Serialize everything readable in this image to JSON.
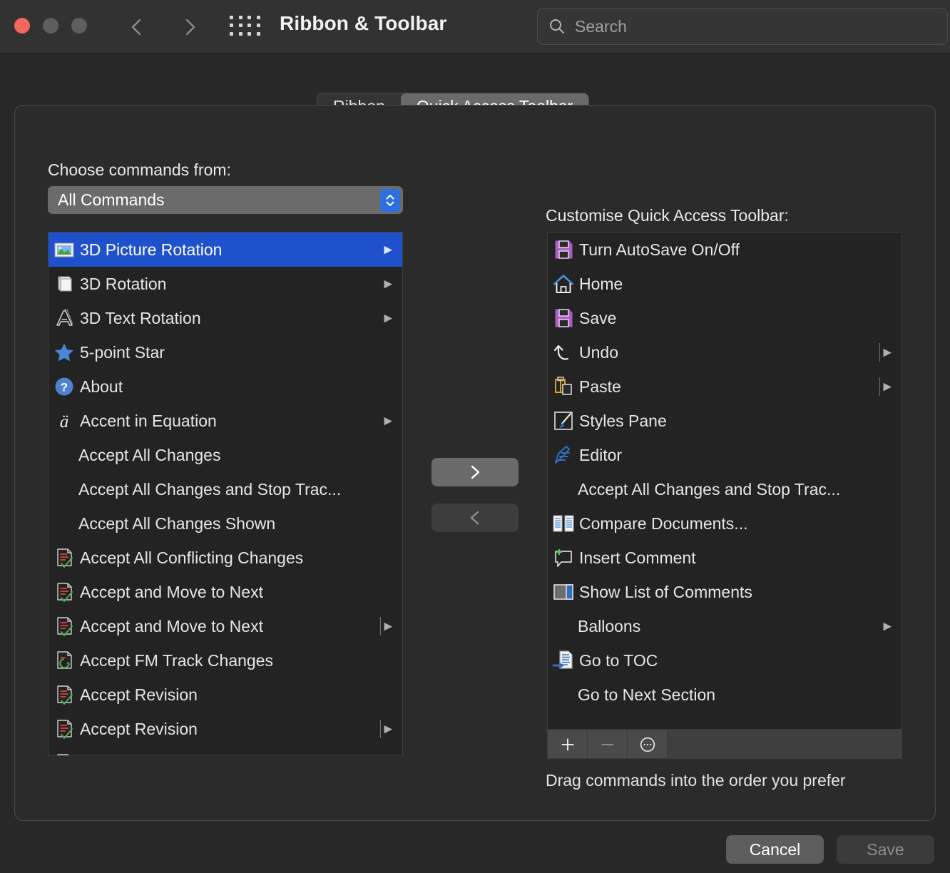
{
  "window": {
    "title": "Ribbon & Toolbar",
    "traffic_lights": [
      "close",
      "minimize",
      "maximize"
    ],
    "nav_back_icon": "chevron-left-icon",
    "nav_forward_icon": "chevron-right-icon",
    "grid_icon": "app-grid-icon"
  },
  "search": {
    "placeholder": "Search",
    "value": "",
    "icon": "search-icon"
  },
  "tabs": [
    {
      "label": "Ribbon",
      "active": false
    },
    {
      "label": "Quick Access Toolbar",
      "active": true
    }
  ],
  "left": {
    "choose_label": "Choose commands from:",
    "select_value": "All Commands",
    "select_stepper_icon": "chevron-up-down-icon",
    "items": [
      {
        "label": "3D Picture Rotation",
        "icon": "picture-icon",
        "submenu": true,
        "selected": true,
        "divider": false
      },
      {
        "label": "3D Rotation",
        "icon": "cube-rotation-icon",
        "submenu": true,
        "selected": false,
        "divider": false
      },
      {
        "label": "3D Text Rotation",
        "icon": "letter-a-3d-icon",
        "submenu": true,
        "selected": false,
        "divider": false
      },
      {
        "label": "5-point Star",
        "icon": "star-icon",
        "submenu": false,
        "selected": false,
        "divider": false
      },
      {
        "label": "About",
        "icon": "question-circle-icon",
        "submenu": false,
        "selected": false,
        "divider": false
      },
      {
        "label": "Accent in Equation",
        "icon": "accent-a-icon",
        "submenu": true,
        "selected": false,
        "divider": false
      },
      {
        "label": "Accept All Changes",
        "icon": "",
        "submenu": false,
        "selected": false,
        "divider": false
      },
      {
        "label": "Accept All Changes and Stop Trac...",
        "icon": "",
        "submenu": false,
        "selected": false,
        "divider": false
      },
      {
        "label": "Accept All Changes Shown",
        "icon": "",
        "submenu": false,
        "selected": false,
        "divider": false
      },
      {
        "label": "Accept All Conflicting Changes",
        "icon": "accept-change-icon",
        "submenu": false,
        "selected": false,
        "divider": false
      },
      {
        "label": "Accept and Move to Next",
        "icon": "accept-change-icon",
        "submenu": false,
        "selected": false,
        "divider": false
      },
      {
        "label": "Accept and Move to Next",
        "icon": "accept-change-icon",
        "submenu": true,
        "selected": false,
        "divider": true
      },
      {
        "label": "Accept FM Track Changes",
        "icon": "refresh-doc-icon",
        "submenu": false,
        "selected": false,
        "divider": false
      },
      {
        "label": "Accept Revision",
        "icon": "accept-change-icon",
        "submenu": false,
        "selected": false,
        "divider": false
      },
      {
        "label": "Accept Revision",
        "icon": "accept-change-icon",
        "submenu": true,
        "selected": false,
        "divider": true
      },
      {
        "label": "",
        "icon": "accept-change-icon",
        "submenu": false,
        "selected": false,
        "divider": false
      }
    ]
  },
  "middle": {
    "add_icon": "chevron-right-icon",
    "remove_icon": "chevron-left-icon"
  },
  "right": {
    "customise_label": "Customise Quick Access Toolbar:",
    "items": [
      {
        "label": "Turn AutoSave On/Off",
        "icon": "floppy-purple-icon",
        "submenu": false,
        "divider": false
      },
      {
        "label": "Home",
        "icon": "home-icon",
        "submenu": false,
        "divider": false
      },
      {
        "label": "Save",
        "icon": "floppy-purple-icon",
        "submenu": false,
        "divider": false
      },
      {
        "label": "Undo",
        "icon": "undo-icon",
        "submenu": true,
        "divider": true
      },
      {
        "label": "Paste",
        "icon": "paste-icon",
        "submenu": true,
        "divider": true
      },
      {
        "label": "Styles Pane",
        "icon": "styles-pane-icon",
        "submenu": false,
        "divider": false
      },
      {
        "label": "Editor",
        "icon": "editor-pen-icon",
        "submenu": false,
        "divider": false
      },
      {
        "label": "Accept All Changes and Stop Trac...",
        "icon": "",
        "submenu": false,
        "divider": false
      },
      {
        "label": "Compare Documents...",
        "icon": "compare-documents-icon",
        "submenu": false,
        "divider": false
      },
      {
        "label": "Insert Comment",
        "icon": "insert-comment-icon",
        "submenu": false,
        "divider": false
      },
      {
        "label": "Show List of Comments",
        "icon": "comments-pane-icon",
        "submenu": false,
        "divider": false
      },
      {
        "label": "Balloons",
        "icon": "",
        "submenu": true,
        "divider": false
      },
      {
        "label": "Go to TOC",
        "icon": "go-to-toc-icon",
        "submenu": false,
        "divider": false
      },
      {
        "label": "Go to Next Section",
        "icon": "",
        "submenu": false,
        "divider": false
      }
    ],
    "toolbar": {
      "add_label": "+",
      "remove_label": "—",
      "more_label": "⋯",
      "add_icon": "plus-icon",
      "remove_icon": "minus-icon",
      "more_icon": "ellipsis-circle-icon"
    },
    "drag_hint": "Drag commands into the order you prefer"
  },
  "footer": {
    "cancel_label": "Cancel",
    "save_label": "Save"
  },
  "colors": {
    "accent_blue": "#1f51cd",
    "window_bg": "#282828",
    "panel_bg": "#2b2b2b",
    "list_bg": "#232323",
    "stepper_blue": "#2d6fe0",
    "purple": "#b05fc4",
    "close_red": "#f2685a"
  }
}
